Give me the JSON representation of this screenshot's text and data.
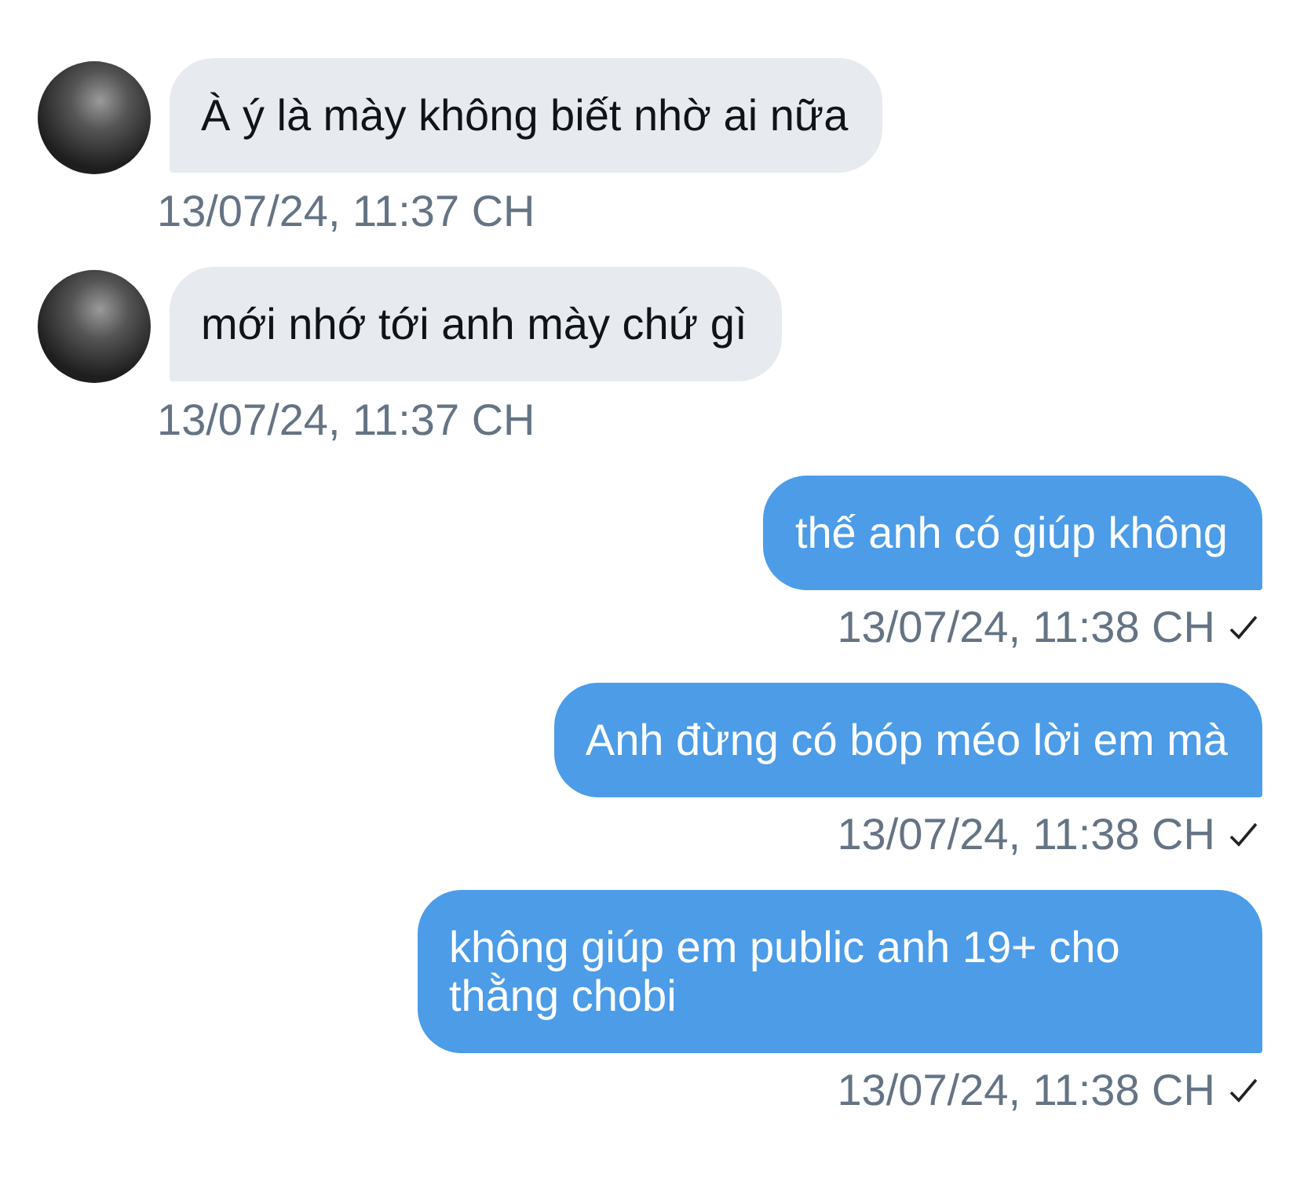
{
  "messages": [
    {
      "kind": "incoming",
      "text": "À ý là mày không biết nhờ ai nữa",
      "time": "13/07/24, 11:37 CH",
      "delivered": false
    },
    {
      "kind": "incoming",
      "text": "mới nhớ tới anh mày chứ gì",
      "time": "13/07/24, 11:37 CH",
      "delivered": false
    },
    {
      "kind": "outgoing",
      "text": "thế anh có giúp không",
      "time": "13/07/24, 11:38 CH",
      "delivered": true
    },
    {
      "kind": "outgoing",
      "text": "Anh đừng có bóp méo lời em mà",
      "time": "13/07/24, 11:38 CH",
      "delivered": true
    },
    {
      "kind": "outgoing",
      "text": "không giúp em public anh 19+ cho thằng chobi",
      "time": "13/07/24, 11:38 CH",
      "delivered": true
    }
  ]
}
